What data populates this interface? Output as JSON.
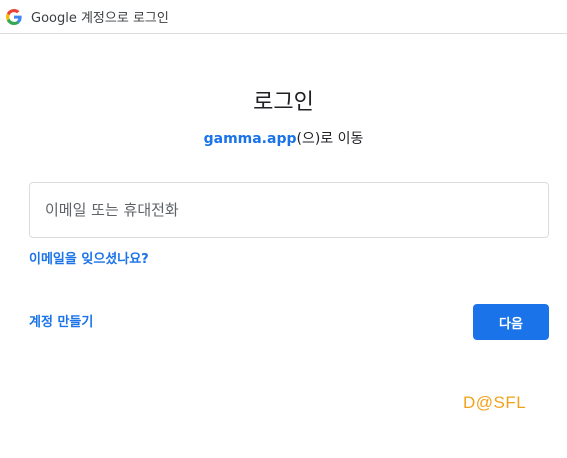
{
  "header": {
    "logo_icon": "google-g-logo-icon",
    "title": "Google 계정으로 로그인"
  },
  "main": {
    "title": "로그인",
    "subtitle_app": "gamma.app",
    "subtitle_suffix": "(으)로 이동",
    "email_input": {
      "value": "",
      "placeholder": "이메일 또는 휴대전화"
    },
    "forgot_email_link": "이메일을 잊으셨나요?",
    "create_account_link": "계정 만들기",
    "next_button": "다음"
  },
  "watermark": "D@SFL",
  "colors": {
    "accent": "#1a73e8",
    "watermark": "#f2a21a",
    "border": "#dadce0"
  }
}
